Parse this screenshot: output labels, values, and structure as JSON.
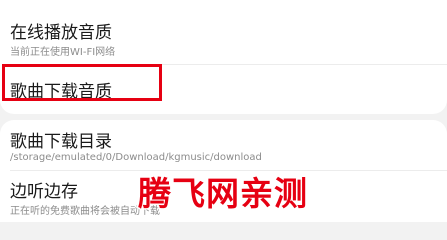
{
  "settings": {
    "items": [
      {
        "title": "在线播放音质",
        "subtitle": "当前正在使用WI-FI网络"
      },
      {
        "title": "歌曲下载音质"
      },
      {
        "title": "歌曲下载目录",
        "subtitle": "/storage/emulated/0/Download/kgmusic/download"
      },
      {
        "title": "边听边存",
        "subtitle": "正在听的免费歌曲将会被自动下载"
      }
    ]
  },
  "watermark": {
    "text": "腾飞网亲测"
  },
  "colors": {
    "highlight": "#e60012",
    "background": "#f2f2f2",
    "card": "#ffffff"
  }
}
